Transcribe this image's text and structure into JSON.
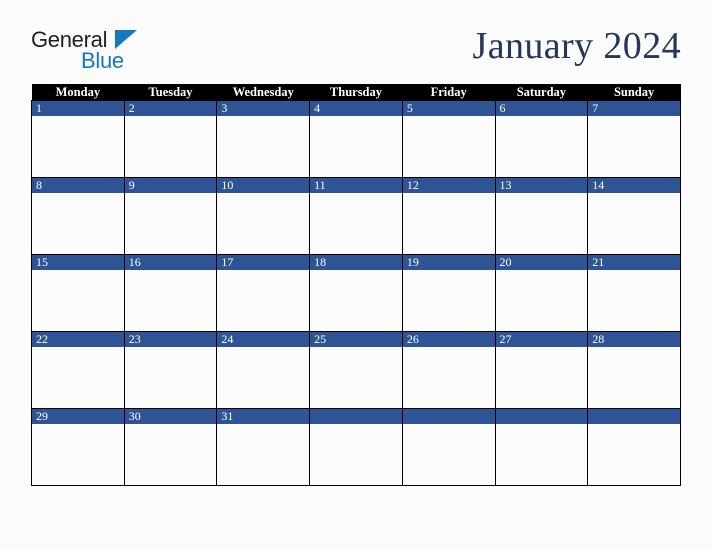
{
  "brand": {
    "name_part1": "General",
    "name_part2": "Blue"
  },
  "header": {
    "title": "January 2024"
  },
  "calendar": {
    "weekday_headers": [
      "Monday",
      "Tuesday",
      "Wednesday",
      "Thursday",
      "Friday",
      "Saturday",
      "Sunday"
    ],
    "weeks": [
      [
        "1",
        "2",
        "3",
        "4",
        "5",
        "6",
        "7"
      ],
      [
        "8",
        "9",
        "10",
        "11",
        "12",
        "13",
        "14"
      ],
      [
        "15",
        "16",
        "17",
        "18",
        "19",
        "20",
        "21"
      ],
      [
        "22",
        "23",
        "24",
        "25",
        "26",
        "27",
        "28"
      ],
      [
        "29",
        "30",
        "31",
        "",
        "",
        "",
        ""
      ]
    ]
  },
  "colors": {
    "accent_blue": "#2f5496",
    "brand_blue": "#1878be",
    "title_navy": "#27365c",
    "header_black": "#000000",
    "page_background": "#fbfbfb"
  }
}
